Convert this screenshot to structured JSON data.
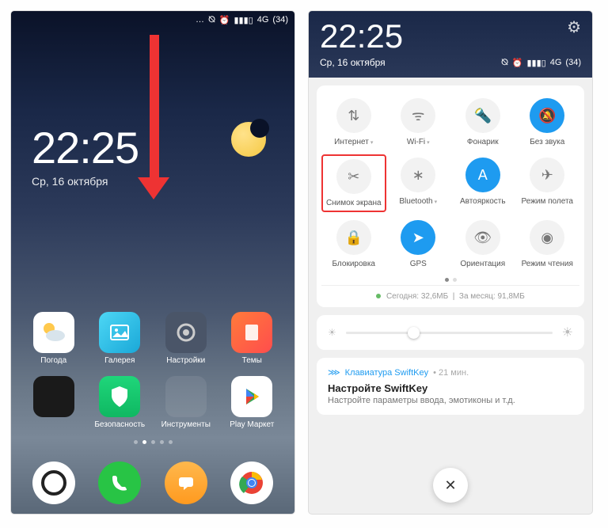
{
  "status": {
    "network": "4G",
    "battery": "34"
  },
  "home": {
    "time": "22:25",
    "date": "Ср, 16 октября",
    "apps_row1": [
      {
        "label": "Погода"
      },
      {
        "label": "Галерея"
      },
      {
        "label": "Настройки"
      },
      {
        "label": "Темы"
      }
    ],
    "apps_row2": [
      {
        "label": "Безопасность"
      },
      {
        "label": "Инструменты"
      },
      {
        "label": "Play Маркет"
      }
    ]
  },
  "panel": {
    "time": "22:25",
    "date": "Ср, 16 октября",
    "toggles": [
      {
        "label": "Интернет",
        "chev": true
      },
      {
        "label": "Wi-Fi",
        "chev": true
      },
      {
        "label": "Фонарик"
      },
      {
        "label": "Без звука",
        "active": true
      },
      {
        "label": "Снимок экрана",
        "highlight": true
      },
      {
        "label": "Bluetooth",
        "chev": true
      },
      {
        "label": "Автояркость",
        "active": true
      },
      {
        "label": "Режим полета"
      },
      {
        "label": "Блокировка"
      },
      {
        "label": "GPS",
        "active": true
      },
      {
        "label": "Ориентация"
      },
      {
        "label": "Режим чтения"
      }
    ],
    "data_today_label": "Сегодня:",
    "data_today": "32,6МБ",
    "data_month_label": "За месяц:",
    "data_month": "91,8МБ",
    "notification": {
      "app": "Клавиатура SwiftKey",
      "time": "21 мин.",
      "title": "Настройте SwiftKey",
      "body": "Настройте параметры ввода, эмотиконы и т.д."
    }
  }
}
